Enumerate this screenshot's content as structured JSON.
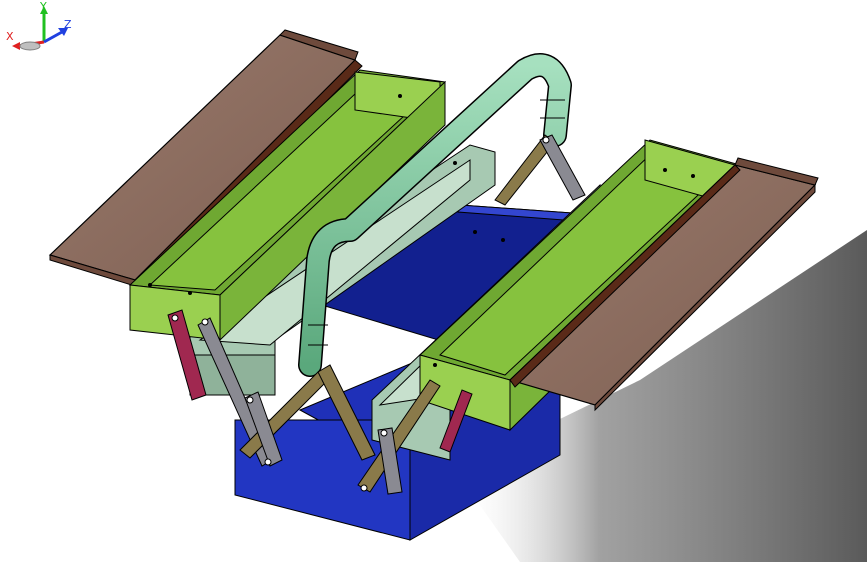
{
  "viewport": {
    "model": "cantilever-toolbox-3d-model",
    "colors": {
      "box_body": "#1a2aa8",
      "box_dark": "#0d1a80",
      "tray": "#86c23e",
      "tray_dark": "#5e8e22",
      "inner_tray": "#a7c9b2",
      "lid": "#8b6b5e",
      "lid_edge": "#5a2a18",
      "handle": "#7ec89e",
      "link_arm": "#8a7a4a",
      "link_red": "#a02850",
      "link_grey": "#8a8a92",
      "shadow": "#6a6a6a"
    }
  },
  "triad": {
    "x_label": "X",
    "y_label": "Y",
    "z_label": "Z",
    "x_color": "#e02020",
    "y_color": "#20c020",
    "z_color": "#2040e0"
  }
}
